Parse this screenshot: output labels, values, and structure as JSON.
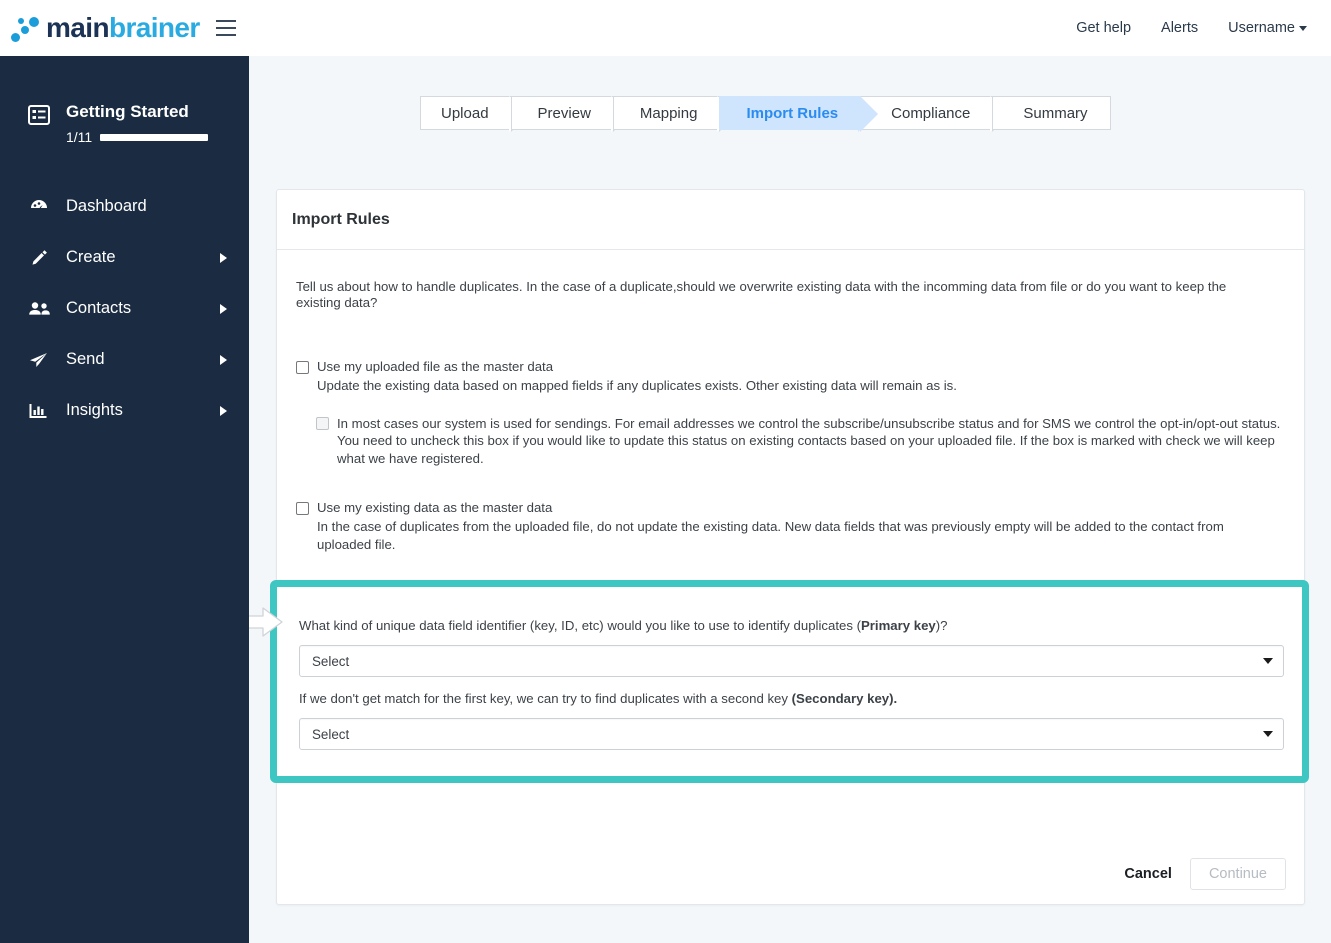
{
  "brand": {
    "logo_main": "main",
    "logo_brainer": "brainer",
    "accent_blue": "#29abe2",
    "dark_navy": "#1c3356"
  },
  "topbar": {
    "menu_toggle": "hamburger-menu",
    "links": [
      {
        "label": "Get help"
      },
      {
        "label": "Alerts"
      },
      {
        "label": "Username",
        "has_caret": true
      }
    ]
  },
  "sidebar": {
    "getting_started": {
      "title": "Getting Started",
      "count": "1/11",
      "progress_percent": 9,
      "progress_color": "#3aa657"
    },
    "items": [
      {
        "label": "Dashboard",
        "icon": "gauge-icon",
        "has_submenu": false
      },
      {
        "label": "Create",
        "icon": "pencil-icon",
        "has_submenu": true
      },
      {
        "label": "Contacts",
        "icon": "people-icon",
        "has_submenu": true
      },
      {
        "label": "Send",
        "icon": "paper-plane-icon",
        "has_submenu": true
      },
      {
        "label": "Insights",
        "icon": "bar-chart-icon",
        "has_submenu": true
      }
    ]
  },
  "wizard": {
    "steps": [
      {
        "label": "Upload",
        "active": false
      },
      {
        "label": "Preview",
        "active": false
      },
      {
        "label": "Mapping",
        "active": false
      },
      {
        "label": "Import Rules",
        "active": true
      },
      {
        "label": "Compliance",
        "active": false
      },
      {
        "label": "Summary",
        "active": false
      }
    ],
    "active_color": "#2b8cf0",
    "active_bg": "#cfe4fd"
  },
  "card": {
    "title": "Import Rules",
    "intro": "Tell us about how to handle duplicates. In the case of a duplicate,should we overwrite existing data with the incomming data from file or do you want to keep the existing data?",
    "option_uploaded": {
      "checkbox_label": "Use my uploaded file as the master data",
      "description": "Update the existing data based on mapped fields if any duplicates exists. Other existing data will remain as is.",
      "checked": false,
      "sub_option": {
        "text": "In most cases our system is used for sendings. For email addresses we control the subscribe/unsubscribe status and for SMS we control the opt-in/opt-out status. You need to uncheck this box if you would like to update this status on existing contacts based on your uploaded file. If the box is marked with check we will keep what we have registered.",
        "checked": false,
        "disabled": true
      }
    },
    "option_existing": {
      "checkbox_label": "Use my existing data as the master data",
      "description": "In the case of duplicates from the uploaded file, do not update the existing data. New data fields that was previously empty will be added to the contact from uploaded file.",
      "checked": false
    },
    "footer": {
      "cancel_label": "Cancel",
      "continue_label": "Continue",
      "continue_disabled": true
    }
  },
  "highlight": {
    "border_color": "#3ec7c2",
    "primary_key": {
      "question_pre": "What kind of unique data field identifier (key, ID, etc) would you like to use to identify duplicates (",
      "question_bold": "Primary key",
      "question_post": ")?",
      "select_value": "Select"
    },
    "secondary_key": {
      "question_pre": "If we don't get match for the first key, we can try to find duplicates with a second key ",
      "question_bold": "(Secondary key).",
      "question_post": "",
      "select_value": "Select"
    }
  }
}
